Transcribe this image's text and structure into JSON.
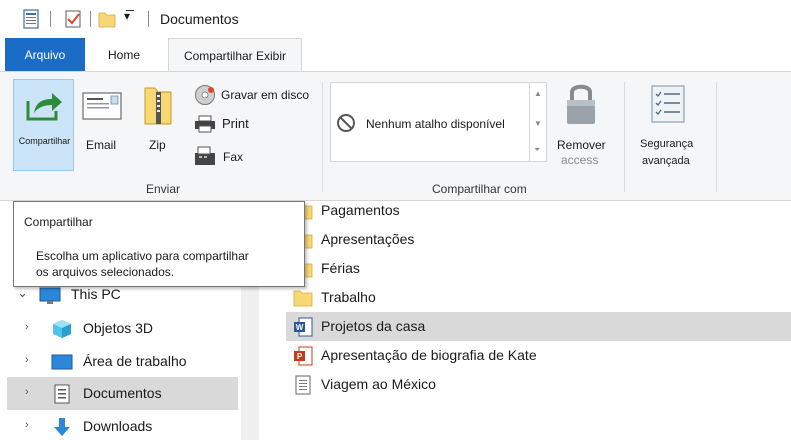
{
  "window": {
    "title": "Documentos"
  },
  "tabs": {
    "file": "Arquivo",
    "home": "Home",
    "share": "Compartilhar",
    "view": "Exibir"
  },
  "ribbon": {
    "share_button": "Compartilhar",
    "email": "Email",
    "zip": "Zip",
    "burn": "Gravar em disco",
    "print": "Print",
    "fax": "Fax",
    "send_group": "Enviar",
    "no_shortcut": "Nenhum atalho disponível",
    "share_with_group": "Compartilhar com",
    "remove_access_1": "Remover",
    "remove_access_2": "access",
    "advanced_security_1": "Segurança",
    "advanced_security_2": "avançada"
  },
  "tooltip": {
    "title": "Compartilhar",
    "body_line1": "Escolha um aplicativo para compartilhar",
    "body_line2": "os arquivos selecionados."
  },
  "nav": {
    "items": [
      {
        "label": "This PC",
        "icon": "computer-icon",
        "expanded": true
      },
      {
        "label": "Objetos 3D",
        "icon": "3d-objects-icon"
      },
      {
        "label": "Área de trabalho",
        "icon": "desktop-icon"
      },
      {
        "label": "Documentos",
        "icon": "documents-icon",
        "selected": true
      },
      {
        "label": "Downloads",
        "icon": "downloads-icon"
      }
    ]
  },
  "files": [
    {
      "label": "Pagamentos",
      "icon": "folder-icon"
    },
    {
      "label": "Apresentações",
      "icon": "folder-icon"
    },
    {
      "label": "Férias",
      "icon": "folder-icon"
    },
    {
      "label": "Trabalho",
      "icon": "folder-icon"
    },
    {
      "label": "Projetos da casa",
      "icon": "word-doc-icon",
      "selected": true
    },
    {
      "label": "Apresentação de biografia de Kate",
      "icon": "powerpoint-icon"
    },
    {
      "label": "Viagem ao México",
      "icon": "text-doc-icon"
    }
  ],
  "colors": {
    "accent": "#1a6cc7",
    "selection": "#d9d9d9",
    "ribbon_bg": "#f5f6f7",
    "folder": "#f8d775"
  }
}
